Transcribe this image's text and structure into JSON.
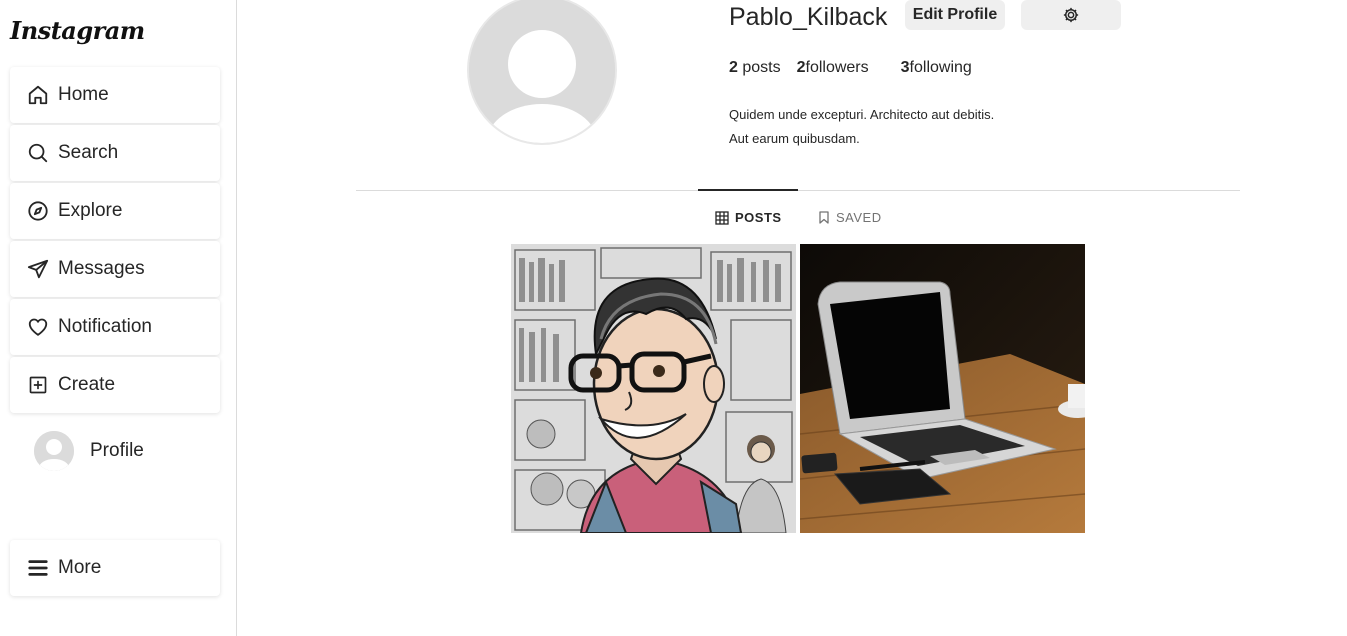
{
  "app": {
    "logo": "Instagram"
  },
  "sidebar": {
    "items": [
      {
        "label": "Home",
        "icon": "home-icon"
      },
      {
        "label": "Search",
        "icon": "search-icon"
      },
      {
        "label": "Explore",
        "icon": "compass-icon"
      },
      {
        "label": "Messages",
        "icon": "send-icon"
      },
      {
        "label": "Notification",
        "icon": "heart-icon"
      },
      {
        "label": "Create",
        "icon": "plus-square-icon"
      }
    ],
    "profile": {
      "label": "Profile"
    },
    "more": {
      "label": "More",
      "icon": "menu-icon"
    }
  },
  "profile": {
    "username": "Pablo_Kilback",
    "edit_button": "Edit Profile",
    "settings_icon": "gear-icon",
    "stats": {
      "posts_count": "2",
      "posts_label": " posts",
      "followers_count": "2",
      "followers_label": "followers",
      "following_count": "3",
      "following_label": "following"
    },
    "bio_line1": "Quidem unde excepturi. Architecto aut debitis.",
    "bio_line2": "Aut earum quibusdam."
  },
  "tabs": [
    {
      "label": "POSTS",
      "icon": "grid-icon",
      "active": true
    },
    {
      "label": "SAVED",
      "icon": "bookmark-icon",
      "active": false
    }
  ],
  "posts": [
    {
      "subject": "illustration-portrait"
    },
    {
      "subject": "laptop-photo"
    }
  ],
  "colors": {
    "border": "#dbdbdb",
    "button_bg": "#efefef",
    "text": "#262626",
    "muted": "#737373"
  }
}
